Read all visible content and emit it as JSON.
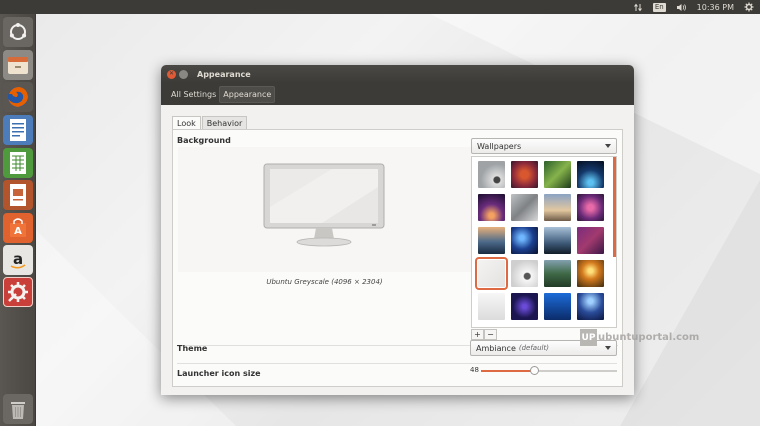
{
  "top_panel": {
    "network_icon": "transfer-arrows-icon",
    "keyboard_layout": "En",
    "volume_icon": "speaker-icon",
    "time": "10:36 PM",
    "settings_icon": "gear-icon"
  },
  "launcher": {
    "items": [
      {
        "name": "dash-button",
        "icon": "ubuntu-logo-icon"
      },
      {
        "name": "files-button",
        "icon": "file-cabinet-icon"
      },
      {
        "name": "firefox-button",
        "icon": "firefox-icon"
      },
      {
        "name": "writer-button",
        "icon": "document-icon"
      },
      {
        "name": "calc-button",
        "icon": "spreadsheet-icon"
      },
      {
        "name": "impress-button",
        "icon": "presentation-icon"
      },
      {
        "name": "software-center-button",
        "icon": "shopping-bag-icon"
      },
      {
        "name": "amazon-button",
        "icon": "amazon-icon"
      },
      {
        "name": "system-settings-button",
        "icon": "settings-gears-icon"
      },
      {
        "name": "trash-button",
        "icon": "trash-icon"
      }
    ]
  },
  "window": {
    "title": "Appearance",
    "breadcrumbs": [
      "All Settings",
      "Appearance"
    ]
  },
  "tabs": [
    {
      "label": "Look",
      "active": true
    },
    {
      "label": "Behavior",
      "active": false
    }
  ],
  "background": {
    "label": "Background",
    "caption": "Ubuntu Greyscale (4096 × 2304)",
    "source_combo": "Wallpapers"
  },
  "theme": {
    "label": "Theme",
    "value": "Ambiance",
    "value_note": "(default)"
  },
  "launcher_icon_size": {
    "label": "Launcher icon size",
    "value": "48",
    "fraction": 0.39
  },
  "buttons": {
    "add": "+",
    "remove": "−"
  },
  "watermark": {
    "badge": "UP",
    "text": "ubuntuportal.com"
  },
  "colors": {
    "accent": "#dd6a43",
    "panel": "#3c3b37"
  }
}
